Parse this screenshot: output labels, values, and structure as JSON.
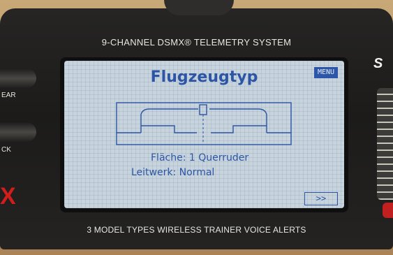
{
  "device": {
    "header": "9-CHANNEL DSMX® TELEMETRY SYSTEM",
    "footer": "3 MODEL TYPES   WIRELESS TRAINER   VOICE ALERTS",
    "side_labels": [
      "EAR",
      "CK"
    ]
  },
  "screen": {
    "title": "Flugzeugtyp",
    "menu_label": "MENU",
    "wing_line": "Fläche: 1 Querruder",
    "tail_line": "Leitwerk: Normal",
    "next_label": ">>"
  },
  "colors": {
    "lcd_background": "#c7d4de",
    "lcd_text": "#2c55a6",
    "menu_background": "#2d56a8",
    "brand_red": "#d21d1d"
  }
}
